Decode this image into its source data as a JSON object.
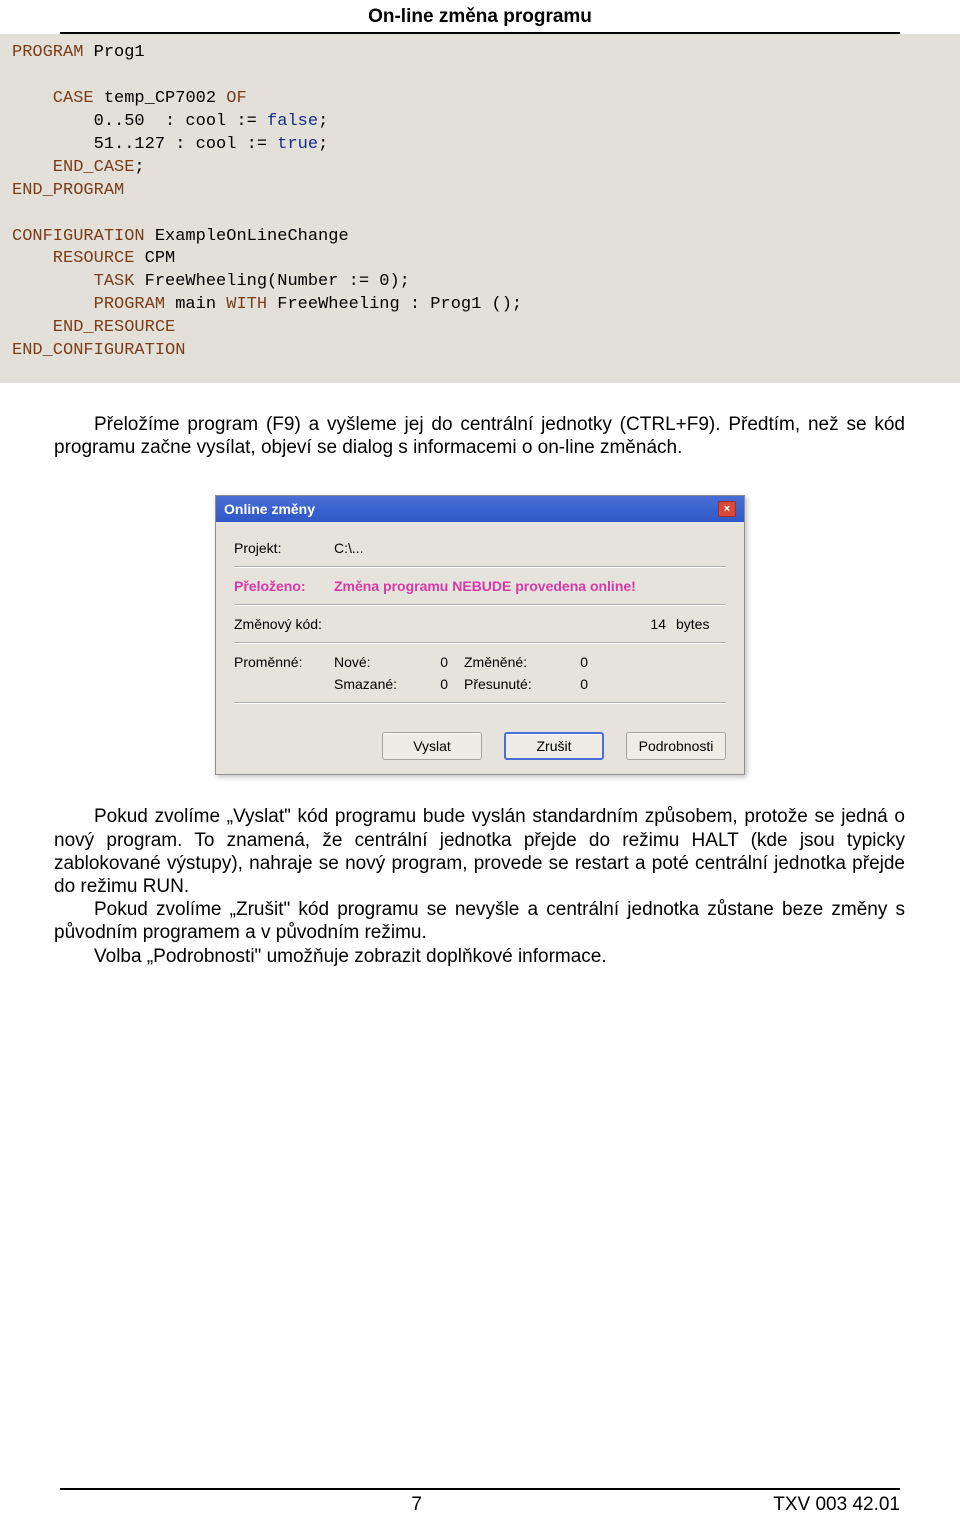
{
  "header": {
    "title": "On-line změna programu"
  },
  "code": {
    "l1": "PROGRAM",
    "l1b": " Prog1",
    "blank": " ",
    "l3a": "    CASE",
    "l3b": " temp_CP7002 ",
    "l3c": "OF",
    "l4a": "        0..50  : cool := ",
    "l4b": "false",
    "l4c": ";",
    "l5a": "        51..127 : cool := ",
    "l5b": "true",
    "l5c": ";",
    "l6": "    END_CASE",
    "l6b": ";",
    "l7": "END_PROGRAM",
    "l8a": "CONFIGURATION",
    "l8b": " ExampleOnLineChange",
    "l9a": "    RESOURCE",
    "l9b": " CPM",
    "l10a": "        TASK",
    "l10b": " FreeWheeling(Number := 0);",
    "l11a": "        PROGRAM",
    "l11b": " main ",
    "l11c": "WITH",
    "l11d": " FreeWheeling : Prog1 ();",
    "l12": "    END_RESOURCE",
    "l13": "END_CONFIGURATION"
  },
  "para1": "Přeložíme program (F9) a vyšleme jej do centrální jednotky (CTRL+F9). Předtím, než se kód programu začne vysílat, objeví se dialog s informacemi o on-line změnách.",
  "dialog": {
    "title": "Online změny",
    "close": "×",
    "projekt_label": "Projekt:",
    "projekt_value": "C:\\...",
    "prelozeno_label": "Přeloženo:",
    "prelozeno_value": "Změna programu NEBUDE provedena online!",
    "kod_label": "Změnový kód:",
    "kod_value": "14",
    "kod_unit": "bytes",
    "prom_label": "Proměnné:",
    "nove_label": "Nové:",
    "nove_val": "0",
    "zmenene_label": "Změněné:",
    "zmenene_val": "0",
    "smazane_label": "Smazané:",
    "smazane_val": "0",
    "presunute_label": "Přesunuté:",
    "presunute_val": "0",
    "btn_vyslat": "Vyslat",
    "btn_zrusit": "Zrušit",
    "btn_podrob": "Podrobnosti"
  },
  "para2": "Pokud zvolíme „Vyslat\" kód programu bude vyslán standardním způsobem, protože se jedná o nový program. To znamená, že centrální jednotka přejde do režimu HALT (kde jsou typicky zablokované výstupy), nahraje se nový program, provede se restart a poté centrální jednotka přejde do režimu RUN.",
  "para3": "Pokud zvolíme „Zrušit\" kód programu se nevyšle a centrální jednotka zůstane beze změny s původním programem a v původním režimu.",
  "para4": "Volba „Podrobnosti\" umožňuje zobrazit doplňkové informace.",
  "footer": {
    "page": "7",
    "docnum": "TXV 003 42.01"
  }
}
